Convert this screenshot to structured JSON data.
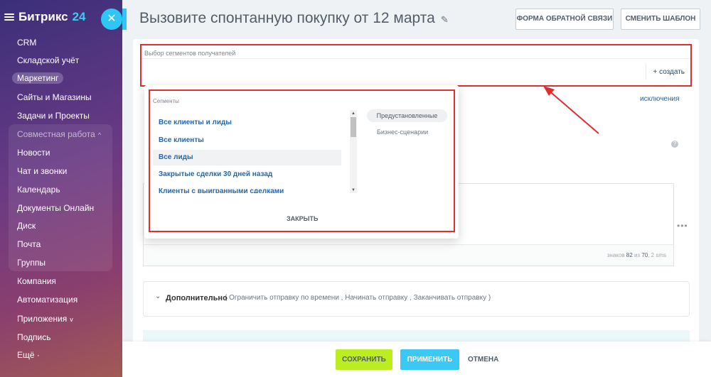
{
  "app": {
    "logo": "Битрикс",
    "logo_number": "24",
    "close_glyph": "✕"
  },
  "sidebar": {
    "items": [
      {
        "label": "CRM"
      },
      {
        "label": "Складской учёт"
      },
      {
        "label": "Маркетинг"
      },
      {
        "label": "Сайты и Магазины"
      },
      {
        "label": "Задачи и Проекты"
      },
      {
        "label": "Совместная работа"
      },
      {
        "label": "Новости"
      },
      {
        "label": "Чат и звонки"
      },
      {
        "label": "Календарь"
      },
      {
        "label": "Документы Онлайн"
      },
      {
        "label": "Диск"
      },
      {
        "label": "Почта"
      },
      {
        "label": "Группы"
      },
      {
        "label": "Компания"
      },
      {
        "label": "Автоматизация"
      },
      {
        "label": "Приложения"
      },
      {
        "label": "Подпись"
      },
      {
        "label": "Ещё"
      }
    ],
    "chevron_up": "^",
    "chevron_down": "v",
    "more_dot": "·"
  },
  "header": {
    "title": "Вызовите спонтанную покупку от 12 марта",
    "pencil": "✎",
    "feedback_label": "ФОРМА ОБРАТНОЙ СВЯЗИ",
    "change_template_label": "СМЕНИТЬ ШАБЛОН"
  },
  "recipients": {
    "label": "Выбор сегментов получателей",
    "create_label": "+ создать",
    "exclusions_label": "исключения"
  },
  "popup": {
    "title": "Сегменты",
    "items": [
      {
        "label": "Все клиенты и лиды"
      },
      {
        "label": "Все клиенты"
      },
      {
        "label": "Все лиды"
      },
      {
        "label": "Закрытые сделки 30 дней назад"
      },
      {
        "label": "Клиенты с выигранными сделками"
      }
    ],
    "categories": [
      "Предустановленные",
      "Бизнес-сценарии"
    ],
    "close_label": "ЗАКРЫТЬ",
    "scroll_up": "▲",
    "scroll_down": "▼"
  },
  "message": {
    "count_prefix": "знаков",
    "count_value": "82",
    "count_of": "из",
    "count_max": "70",
    "count_sms": ", 2 sms",
    "more_dots": "•••",
    "info_glyph": "?"
  },
  "extra": {
    "chevron": "⌄",
    "title": "Дополнительно",
    "options": "( Ограничить отправку по времени ,  Начинать отправку ,  Заканчивать отправку )"
  },
  "footer": {
    "save_label": "СОХРАНИТЬ",
    "apply_label": "ПРИМЕНИТЬ",
    "cancel_label": "ОТМЕНА"
  },
  "colors": {
    "accent": "#2fc6f6",
    "highlight_red": "#e02e2e",
    "save_green": "#bbed21",
    "apply_blue": "#3bc8f5"
  }
}
